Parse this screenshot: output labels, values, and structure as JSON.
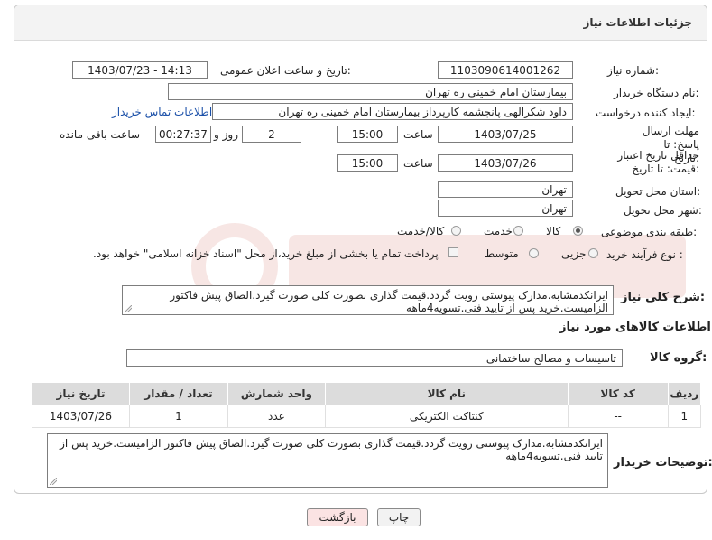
{
  "header": {
    "title": "جزئیات اطلاعات نیاز"
  },
  "fields": {
    "need_number_label": "شماره نیاز:",
    "need_number": "1103090614001262",
    "announce_label": "تاریخ و ساعت اعلان عمومی:",
    "announce_value": "1403/07/23 - 14:13",
    "buyer_org_label": "نام دستگاه خریدار:",
    "buyer_org": "بیمارستان امام خمینی ره  تهران",
    "requester_label": "ایجاد کننده درخواست:",
    "requester": "داود شکرالهی پانچشمه کارپرداز بیمارستان امام خمینی ره  تهران",
    "contact_link": "اطلاعات تماس خریدار",
    "deadline_label": "مهلت ارسال پاسخ: تا تاریخ:",
    "deadline_date": "1403/07/25",
    "time_label": "ساعت",
    "deadline_time": "15:00",
    "days_value": "2",
    "days_label": "روز و",
    "remaining_value": "00:27:37",
    "remaining_label": "ساعت باقی مانده",
    "validity_label": "حداقل تاریخ اعتبار قیمت: تا تاریخ:",
    "validity_date": "1403/07/26",
    "validity_time": "15:00",
    "province_label": "استان محل تحویل:",
    "province": "تهران",
    "city_label": "شهر محل تحویل:",
    "city": "تهران",
    "category_label": "طبقه بندی موضوعی:",
    "category_options": [
      "کالا",
      "خدمت",
      "کالا/خدمت"
    ],
    "process_label": "نوع فرآیند خرید :",
    "process_options": [
      "جزیی",
      "متوسط"
    ],
    "payment_note": "پرداخت تمام یا بخشی از مبلغ خرید،از محل \"اسناد خزانه اسلامی\" خواهد بود."
  },
  "description": {
    "label": "شرح کلی نیاز:",
    "text": "ایرانکدمشابه.مدارک پیوستی رویت گردد.قیمت گذاری بصورت کلی صورت گیرد.الصاق پیش فاکتور الزامیست.خرید پس از تایید فنی.تسویه4ماهه"
  },
  "goods_section": {
    "title": "اطلاعات کالاهای مورد نیاز"
  },
  "goods_group": {
    "label": "گروه کالا:",
    "value": "تاسیسات و مصالح ساختمانی"
  },
  "table": {
    "headers": [
      "ردیف",
      "کد کالا",
      "نام کالا",
      "واحد شمارش",
      "تعداد / مقدار",
      "تاریخ نیاز"
    ],
    "rows": [
      [
        "1",
        "--",
        "کنتاکت الکتریکی",
        "عدد",
        "1",
        "1403/07/26"
      ]
    ]
  },
  "buyer_notes": {
    "label": "توضیحات خریدار:",
    "text": "ایرانکدمشابه.مدارک پیوستی رویت گردد.قیمت گذاری بصورت کلی صورت گیرد.الصاق پیش فاکتور الزامیست.خرید پس از تایید فنی.تسویه4ماهه"
  },
  "buttons": {
    "print": "چاپ",
    "back": "بازگشت"
  },
  "colors": {
    "header_bg": "#f3f3f3",
    "link": "#1a4fa8",
    "table_header": "#dcdcdc",
    "back_button_bg": "#fbe3e3"
  }
}
